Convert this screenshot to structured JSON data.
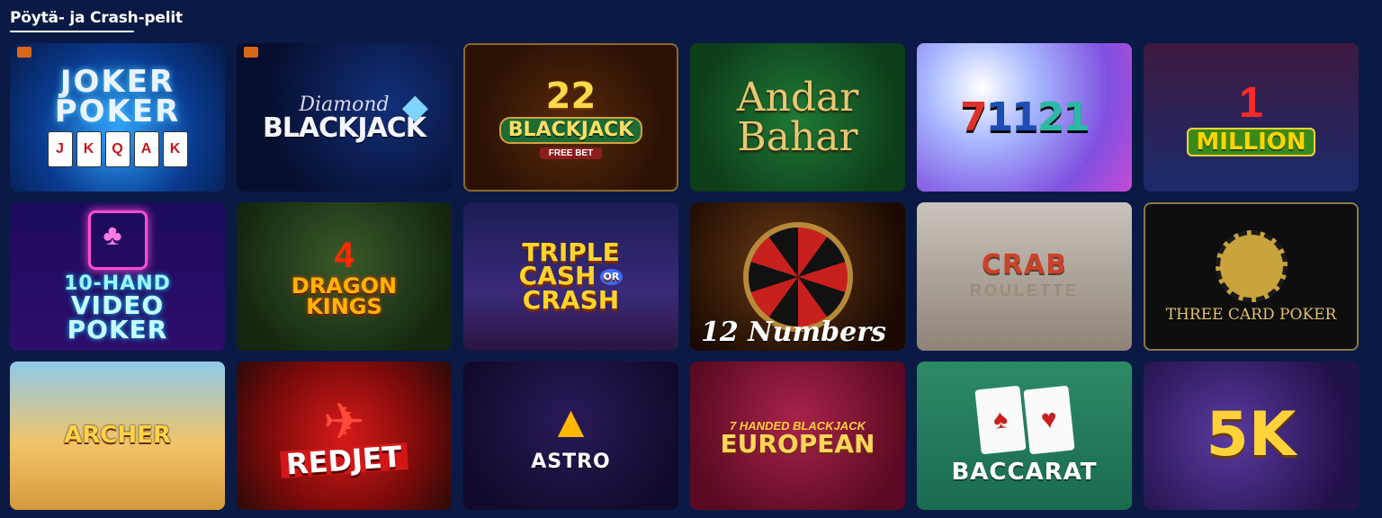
{
  "section": {
    "title": "Pöytä- ja Crash-pelit"
  },
  "tiles": [
    {
      "id": "joker",
      "title": "JOKER POKER",
      "cards": [
        "J",
        "K",
        "Q",
        "A",
        "K"
      ]
    },
    {
      "id": "diamond",
      "script": "Diamond",
      "title": "BLACKJACK"
    },
    {
      "id": "bj22",
      "number": "22",
      "title": "BLACKJACK",
      "sub": "FREE BET"
    },
    {
      "id": "andar",
      "title_line1": "Andar",
      "title_line2": "Bahar"
    },
    {
      "id": "s71121",
      "p1": "7",
      "p2": "11",
      "p3": "21"
    },
    {
      "id": "million",
      "number": "1",
      "title": "MILLION"
    },
    {
      "id": "tenhand",
      "line1": "10-HAND",
      "line2": "VIDEO",
      "line3": "POKER"
    },
    {
      "id": "dragon",
      "number": "4",
      "title_line1": "DRAGON",
      "title_line2": "KINGS"
    },
    {
      "id": "triple",
      "line1": "TRIPLE",
      "line2": "CASH",
      "or": "OR",
      "line3": "CRASH"
    },
    {
      "id": "twelve",
      "title": "12 Numbers"
    },
    {
      "id": "crab",
      "title": "CRAB",
      "sub": "ROULETTE"
    },
    {
      "id": "three",
      "title": "THREE CARD POKER"
    },
    {
      "id": "archer",
      "title": "ARCHER"
    },
    {
      "id": "redjet",
      "title": "REDJET"
    },
    {
      "id": "astro",
      "title": "ASTRO"
    },
    {
      "id": "euro",
      "sub": "7 HANDED BLACKJACK",
      "title": "EUROPEAN"
    },
    {
      "id": "baccarat",
      "title": "BACCARAT"
    },
    {
      "id": "fivek",
      "title": "5K"
    }
  ]
}
